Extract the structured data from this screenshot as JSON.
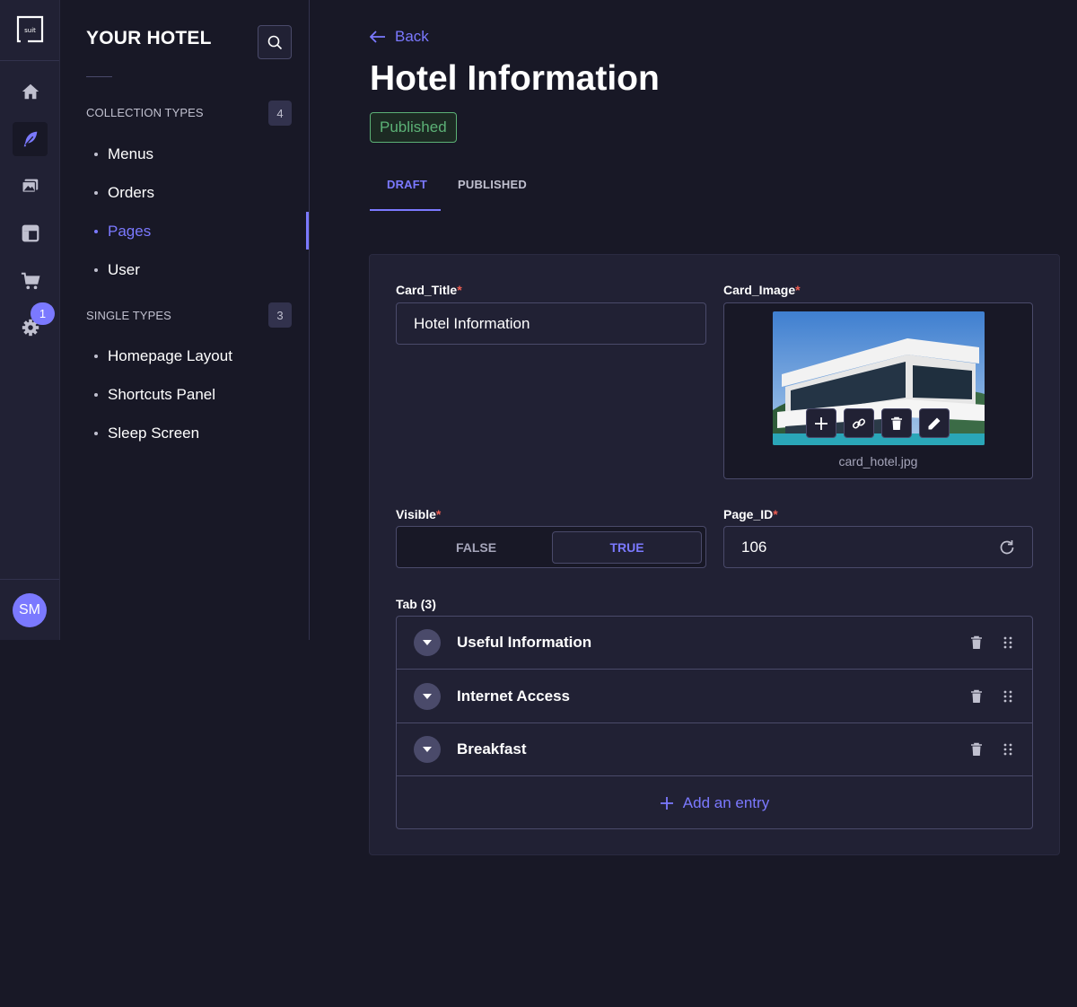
{
  "sidebar": {
    "brand": "YOUR HOTEL",
    "collection_types": {
      "heading": "COLLECTION TYPES",
      "count": "4",
      "items": [
        "Menus",
        "Orders",
        "Pages",
        "User"
      ]
    },
    "single_types": {
      "heading": "SINGLE TYPES",
      "count": "3",
      "items": [
        "Homepage Layout",
        "Shortcuts Panel",
        "Sleep Screen"
      ]
    },
    "active_item": "Pages"
  },
  "rail": {
    "logo_text": "suit",
    "items": [
      "home-icon",
      "feather-icon",
      "media-library-icon",
      "layout-icon",
      "cart-icon",
      "settings-icon"
    ],
    "settings_badge": "1",
    "avatar_initials": "SM"
  },
  "header": {
    "back_label": "Back",
    "title": "Hotel Information",
    "status": "Published"
  },
  "tabs": [
    {
      "label": "DRAFT",
      "active": true
    },
    {
      "label": "PUBLISHED",
      "active": false
    }
  ],
  "form": {
    "card_title": {
      "label": "Card_Title",
      "required": "*",
      "value": "Hotel Information"
    },
    "card_image": {
      "label": "Card_Image",
      "required": "*",
      "filename": "card_hotel.jpg"
    },
    "visible": {
      "label": "Visible",
      "required": "*",
      "options": [
        "FALSE",
        "TRUE"
      ],
      "selected": "TRUE"
    },
    "page_id": {
      "label": "Page_ID",
      "required": "*",
      "value": "106"
    },
    "tab": {
      "label": "Tab (3)",
      "entries": [
        "Useful Information",
        "Internet Access",
        "Breakfast"
      ],
      "add_label": "Add an entry"
    }
  },
  "colors": {
    "accent": "#7b79ff",
    "background": "#181826",
    "surface": "#212134",
    "success": "#5cb176",
    "danger": "#ee5e52"
  }
}
